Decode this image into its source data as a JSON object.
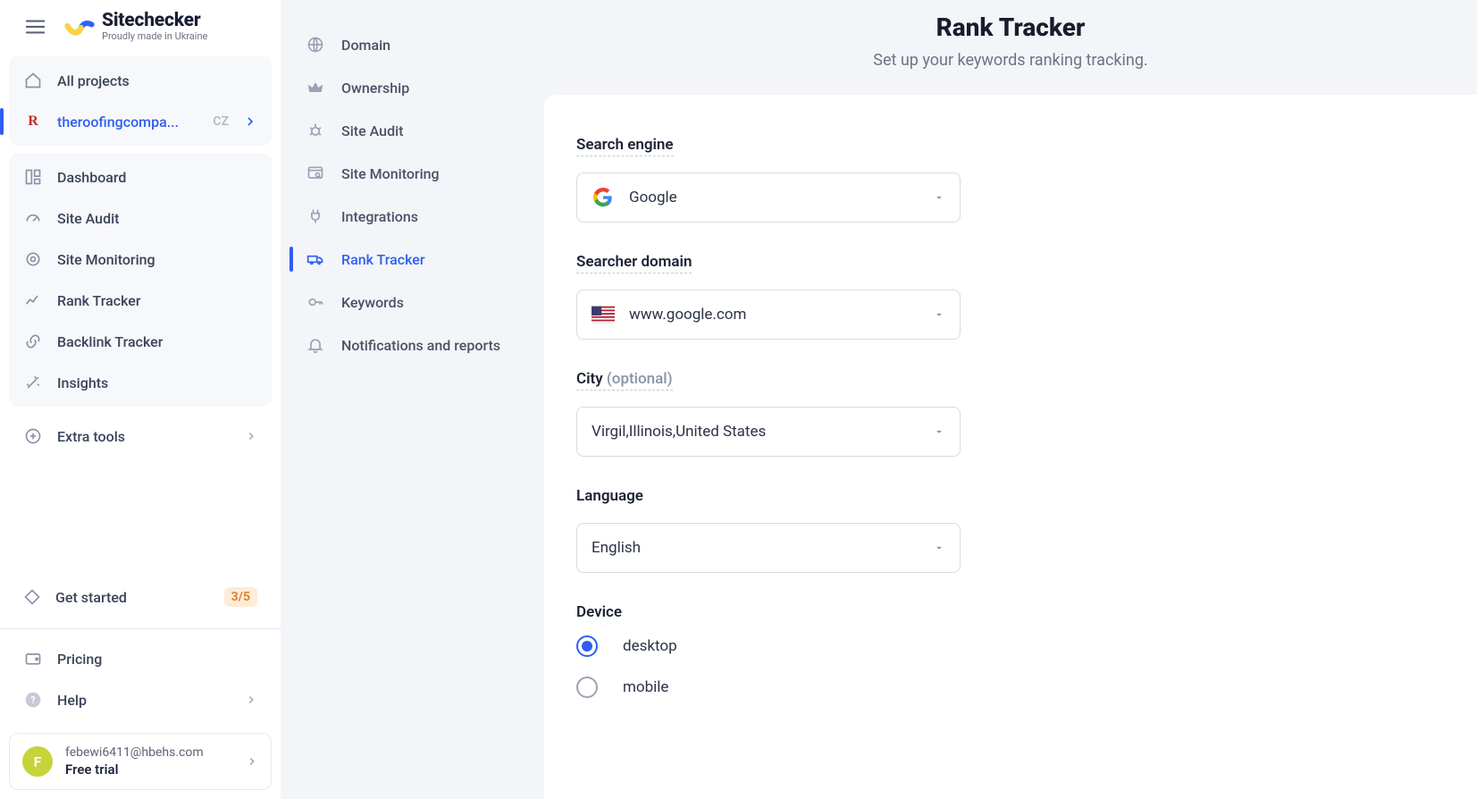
{
  "brand": {
    "title": "Sitechecker",
    "tagline": "Proudly made in Ukraine"
  },
  "sidebar": {
    "all_projects": "All projects",
    "project": {
      "name": "theroofingcompa...",
      "tag": "CZ"
    },
    "items": {
      "dashboard": "Dashboard",
      "site_audit": "Site Audit",
      "site_monitoring": "Site Monitoring",
      "rank_tracker": "Rank Tracker",
      "backlink_tracker": "Backlink Tracker",
      "insights": "Insights"
    },
    "extra_tools": "Extra tools",
    "get_started": {
      "label": "Get started",
      "count": "3/5"
    },
    "pricing": "Pricing",
    "help": "Help",
    "user": {
      "email": "febewi6411@hbehs.com",
      "plan": "Free trial",
      "initial": "F"
    }
  },
  "settings": {
    "domain": "Domain",
    "ownership": "Ownership",
    "site_audit": "Site Audit",
    "site_monitoring": "Site Monitoring",
    "integrations": "Integrations",
    "rank_tracker": "Rank Tracker",
    "keywords": "Keywords",
    "notifications": "Notifications and reports"
  },
  "page": {
    "title": "Rank Tracker",
    "subtitle": "Set up your keywords ranking tracking."
  },
  "form": {
    "search_engine": {
      "label": "Search engine",
      "value": "Google"
    },
    "searcher_domain": {
      "label": "Searcher domain",
      "value": "www.google.com"
    },
    "city": {
      "label": "City",
      "optional": "(optional)",
      "value": "Virgil,Illinois,United States"
    },
    "language": {
      "label": "Language",
      "value": "English"
    },
    "device": {
      "label": "Device",
      "options": {
        "desktop": "desktop",
        "mobile": "mobile"
      },
      "selected": "desktop"
    }
  }
}
